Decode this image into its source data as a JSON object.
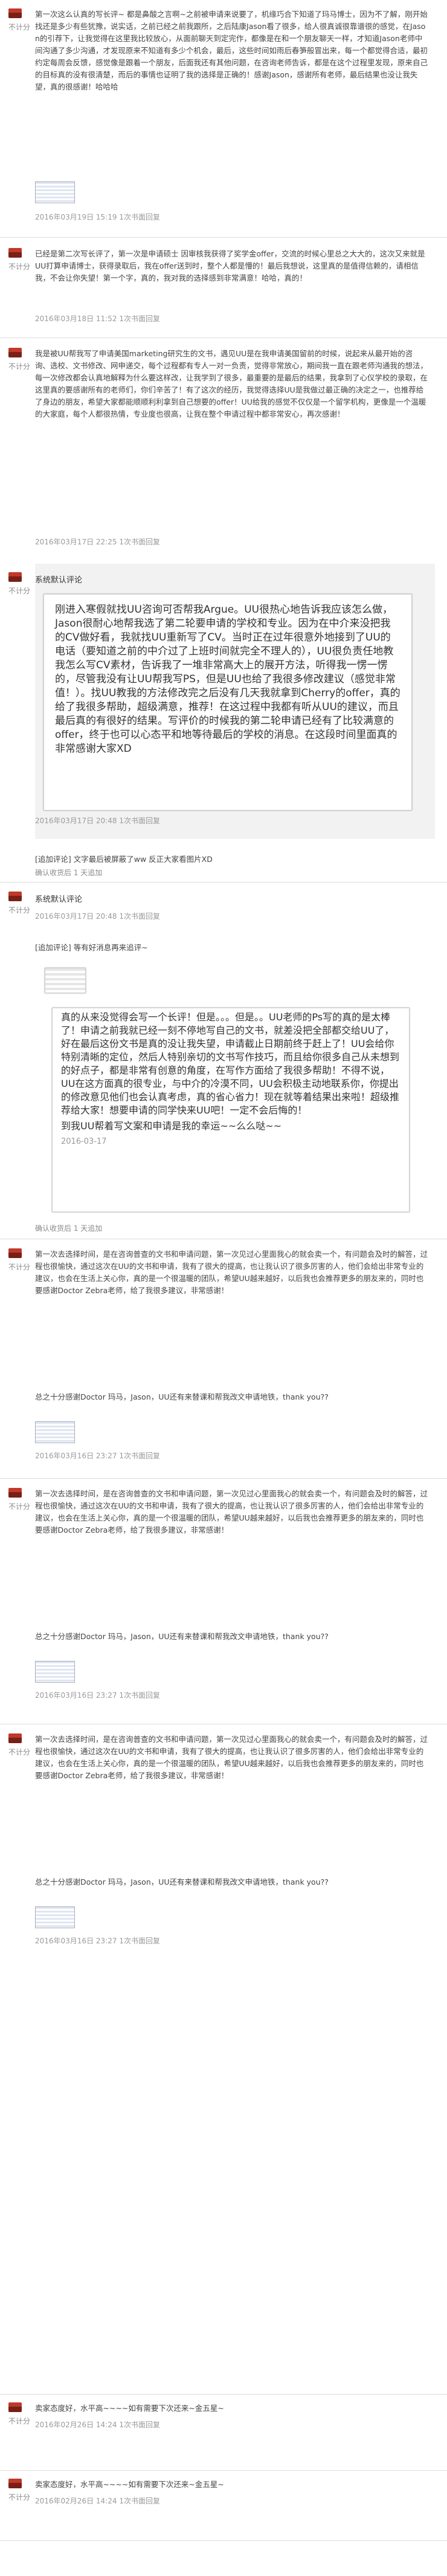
{
  "review1": {
    "rating": "不计分",
    "body": "第一次这么认真的写长评~ 都是鼻酸之言啊~之前被申请来说要了，机缘巧合下知道了玛马博士，因为不了解，刚开始找还是多少有些犹豫，说实话，之前已经之前我跟所，之后陆康Jason看了很多，给人很真诚很靠谱很的感觉，在Jason的引荐下，让我觉得在这里我比较放心，从面前聊天到定完作，都像是在和一个朋友聊天一样，才知道Jason老师中间沟通了多少沟通，才发现原来不知道有多少个机会，最后，这些时间如雨后春笋般冒出来，每一个都觉得合适，最初约定每周会反馈，感觉像是跟着一个朋友，后面我还有其他问题，在咨询老师告诉，都是在这个过程里发现，原来自己的目标真的没有很清楚，而后的事情也证明了我的选择是正确的！感谢Jason，感谢所有老师，最后结果也没让我失望，真的很感谢！哈哈哈",
    "date": "2016年03月19日 15:19",
    "reply_count": "1次书面回复"
  },
  "review2": {
    "rating": "不计分",
    "body": "已经是第二次写长评了，第一次是申请硕士 因审核我获得了奖学金offer，交流的时候心里总之大大的，这次又来就是UU打算申请博士，获得录取后，我在offer送到时，整个人都是懵的！最后我想说，这里真的是值得信赖的，请相信我，不会让你失望！第一个字，真的，我对我的选择感到非常满意！哈哈，真的！",
    "date": "2016年03月18日 11:52",
    "reply_count": "1次书面回复"
  },
  "review3": {
    "rating": "不计分",
    "body": "我是被UU帮我写了申请美国marketing研究生的文书，遇见UU是在我申请美国留前的时候，说起来从最开始的咨询、选校、文书修改、网申递交，每个过程都有专人一对一负责，觉得非常放心，期间我一直在跟老师沟通我的想法，每一次修改都会认真地解释为什么要这样改，让我学到了很多，最重要的是最后的结果，我拿到了心仪学校的录取，在这里真的要感谢所有的老师们，你们辛苦了！有了这次的经历，我觉得选择UU是我做过最正确的决定之一，也推荐给了身边的朋友，希望大家都能顺顺利利拿到自己想要的offer！UU给我的感觉不仅仅是一个留学机构，更像是一个温暖的大家庭，每个人都很热情，专业度也很高，让我在整个申请过程中都非常安心，再次感谢！",
    "date": "2016年03月17日 22:25",
    "reply_count": "1次书面回复"
  },
  "sys1": {
    "rating": "不计分",
    "title": "系统默认评论",
    "image_text": "刚进入寒假就找UU咨询可否帮我Argue。UU很热心地告诉我应该怎么做，Jason很耐心地帮我选了第二轮要申请的学校和专业。因为在中介来没把我的CV做好看，我就找UU重新写了CV。当时正在过年很意外地接到了UU的电话（要知道之前的中介过了上班时间就完全不理人的），UU很负责任地教我怎么写CV素材，告诉我了一堆非常高大上的展开方法，听得我一愣一愣的，尽管我没有让UU帮我写PS，但是UU也给了我很多修改建议（感觉非常值！）。找UU教我的方法修改完之后没有几天我就拿到Cherry的offer，真的给了我很多帮助，超级满意，推荐！在这过程中我都有听从UU的建议，而且最后真的有很好的结果。写评价的时候我的第二轮申请已经有了比较满意的offer，终于也可以心态平和地等待最后的学校的消息。在这段时间里面真的非常感谢大家XD",
    "date": "2016年03月17日 20:48",
    "reply_count": "1次书面回复"
  },
  "addon1": {
    "label": "[追加评论]",
    "text": "文字最后被屏蔽了ww 反正大家看图片XD",
    "note": "确认收货后 1 天追加"
  },
  "sys2": {
    "rating": "不计分",
    "title": "系统默认评论",
    "date": "2016年03月17日 20:48",
    "reply_count": "1次书面回复"
  },
  "addon2": {
    "label": "[追加评论]",
    "text": "等有好消息再来追评~",
    "note": "确认收货后 1 天追加"
  },
  "screenshot2": {
    "text": "真的从来没觉得会写一个长评！但是。。。但是。。UU老师的Ps写的真的是太棒了！申请之前我就已经一刻不停地写自己的文书，就差没把全部都交给UU了，好在最后这份文书是真的没让我失望，申请截止日期前终于赶上了！UU会给你特别清晰的定位，然后人特别亲切的文书写作技巧，而且给你很多自己从未想到的好点子，都是非常有创意的角度，在写作方面给了我很多帮助！不得不说，UU在这方面真的很专业，与中介的冷漠不同，UU会积极主动地联系你，你提出的修改意见他们也会认真考虑，真的省心省力！现在就等着结果出来啦！超级推荐给大家！想要申请的同学快来UU吧！一定不会后悔的！",
    "sign": "到我UU帮着写文案和申请是我的幸运~~么么哒~~",
    "date": "2016-03-17",
    "note": "确认收货后 1 天追加"
  },
  "review4": {
    "rating": "不计分",
    "body": "第一次去选择时间，是在咨询普查的文书和申请问题，第一次见过心里面我心的就会卖一个，有问题会及时的解答，过程也很愉快，通过这次在UU的文书和申请，我有了很大的提高，也让我认识了很多厉害的人，他们会给出非常专业的建议，也会在生活上关心你，真的是一个很温暖的团队，希望UU越来越好，以后我也会推荐更多的朋友来的，同时也要感谢Doctor Zebra老师，给了我很多建议，非常感谢！",
    "thanks": "总之十分感谢Doctor 玛马，Jason，UU还有来替课和帮我改文申请地铁，thank you??",
    "date": "2016年03月16日 23:27",
    "reply_count": "1次书面回复"
  },
  "review5": {
    "rating": "不计分",
    "body": "第一次去选择时间，是在咨询普查的文书和申请问题，第一次见过心里面我心的就会卖一个，有问题会及时的解答，过程也很愉快，通过这次在UU的文书和申请，我有了很大的提高，也让我认识了很多厉害的人，他们会给出非常专业的建议，也会在生活上关心你，真的是一个很温暖的团队，希望UU越来越好，以后我也会推荐更多的朋友来的，同时也要感谢Doctor Zebra老师，给了我很多建议，非常感谢！",
    "thanks": "总之十分感谢Doctor 玛马，Jason，UU还有来替课和帮我改文申请地铁，thank you??",
    "date": "2016年03月16日 23:27",
    "reply_count": "1次书面回复"
  },
  "review6": {
    "rating": "不计分",
    "body": "第一次去选择时间，是在咨询普查的文书和申请问题，第一次见过心里面我心的就会卖一个，有问题会及时的解答，过程也很愉快，通过这次在UU的文书和申请，我有了很大的提高，也让我认识了很多厉害的人，他们会给出非常专业的建议，也会在生活上关心你，真的是一个很温暖的团队，希望UU越来越好，以后我也会推荐更多的朋友来的，同时也要感谢Doctor Zebra老师，给了我很多建议，非常感谢！",
    "thanks": "总之十分感谢Doctor 玛马，Jason，UU还有来替课和帮我改文申请地铁，thank you??",
    "date": "2016年03月16日 23:27",
    "reply_count": "1次书面回复"
  },
  "review7": {
    "rating": "不计分",
    "body": "卖家态度好，水平高~~~~如有需要下次还来~金五星~",
    "date": "2016年02月26日 14:24",
    "reply_count": "1次书面回复"
  },
  "review8": {
    "rating": "不计分",
    "body": "卖家态度好，水平高~~~~如有需要下次还来~金五星~",
    "date": "2016年02月26日 14:24",
    "reply_count": "1次书面回复"
  }
}
